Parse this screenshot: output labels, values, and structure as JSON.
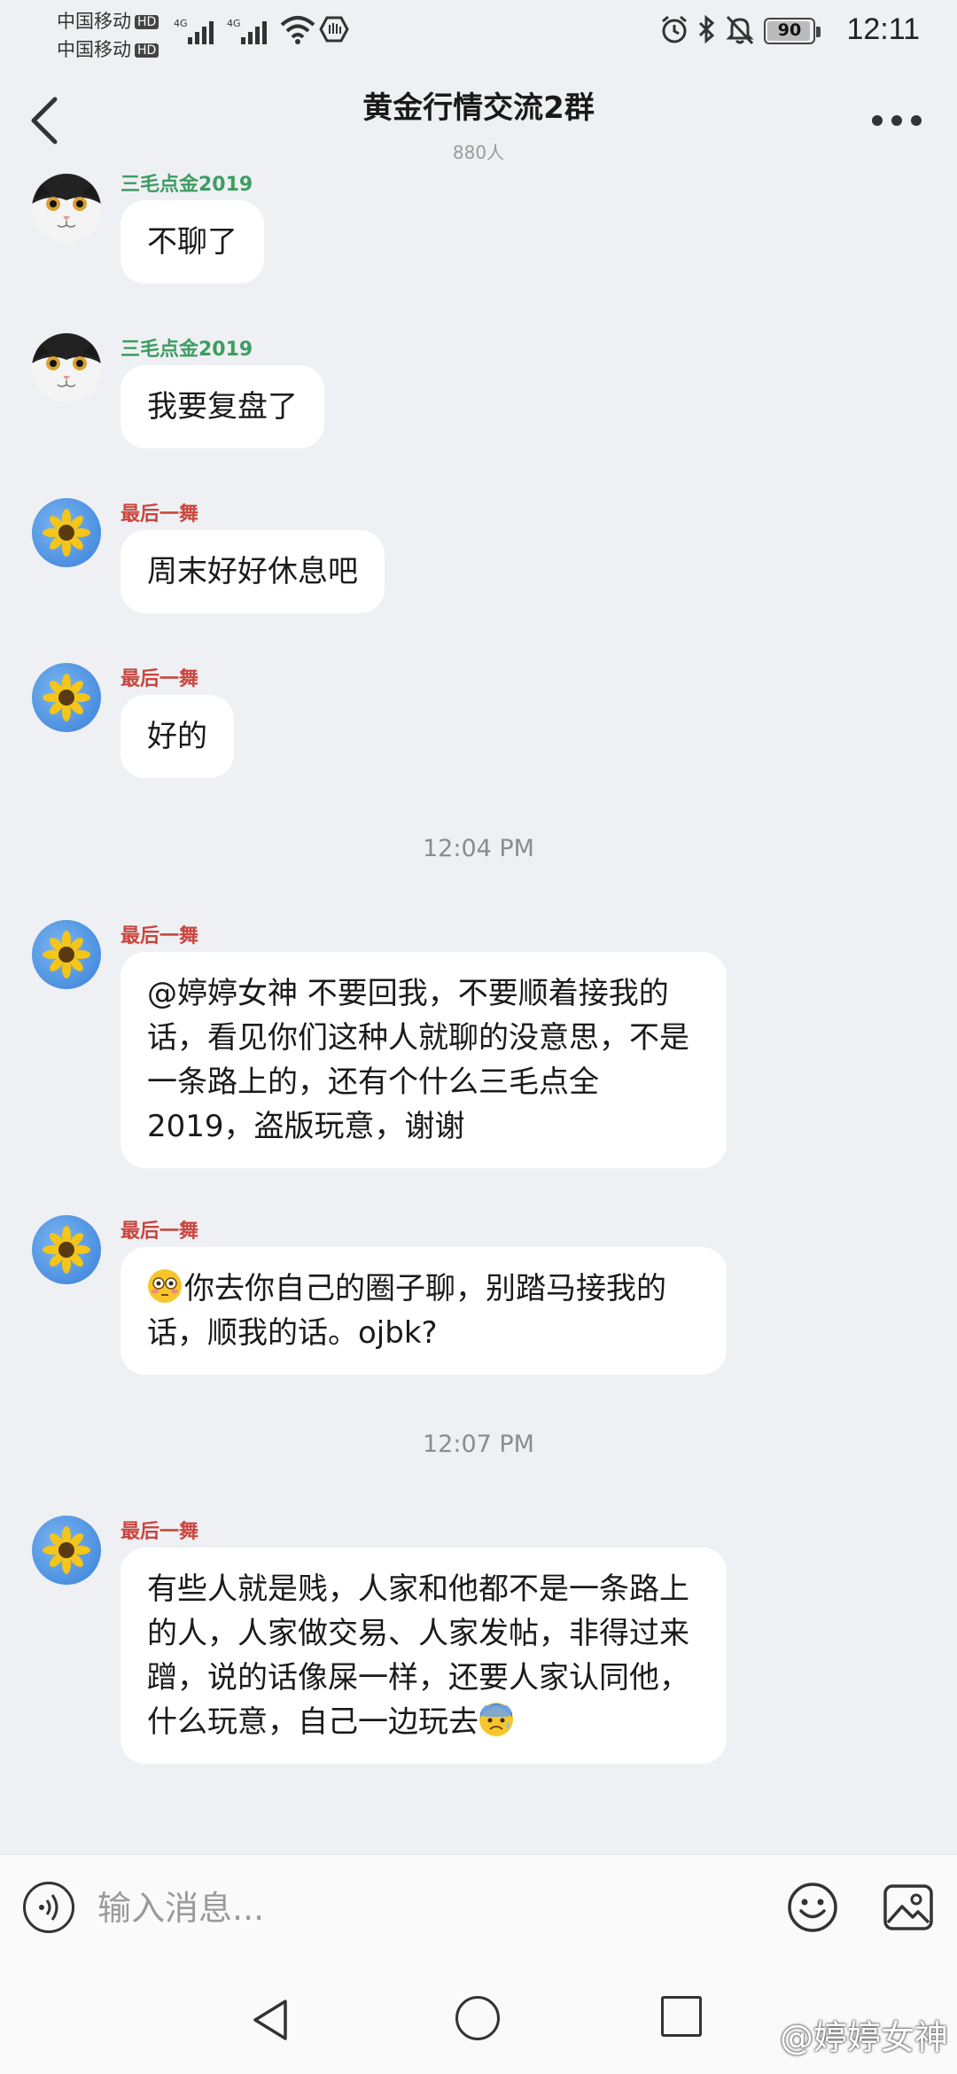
{
  "status_bar": {
    "carrier1": "中国移动",
    "carrier2": "中国移动",
    "hd": "HD",
    "network": "4G",
    "battery": "90",
    "time": "12:11"
  },
  "header": {
    "title": "黄金行情交流2群",
    "member_count": "880人"
  },
  "messages": [
    {
      "sender": "三毛点金2019",
      "avatar": "cat-avatar",
      "text": "不聊了"
    },
    {
      "sender": "三毛点金2019",
      "avatar": "cat-avatar",
      "text": "我要复盘了"
    },
    {
      "sender": "最后一舞",
      "avatar": "sunflower-avatar",
      "text": "周末好好休息吧"
    },
    {
      "sender": "最后一舞",
      "avatar": "sunflower-avatar",
      "text": "好的"
    },
    {
      "timestamp": "12:04 PM"
    },
    {
      "sender": "最后一舞",
      "avatar": "sunflower-avatar",
      "text": "@婷婷女神 不要回我，不要顺着接我的话，看见你们这种人就聊的没意思，不是一条路上的，还有个什么三毛点全2019，盗版玩意，谢谢"
    },
    {
      "sender": "最后一舞",
      "avatar": "sunflower-avatar",
      "emoji": "flushed-face-emoji",
      "text": "你去你自己的圈子聊，别踏马接我的话，顺我的话。ojbk?"
    },
    {
      "timestamp": "12:07 PM"
    },
    {
      "sender": "最后一舞",
      "avatar": "sunflower-avatar",
      "text": "有些人就是贱，人家和他都不是一条路上的人，人家做交易、人家发帖，非得过来蹭，说的话像屎一样，还要人家认同他，什么玩意，自己一边玩去",
      "emoji": "anxious-face-emoji"
    }
  ],
  "input": {
    "placeholder": "输入消息..."
  },
  "watermark": "@婷婷女神",
  "colors": {
    "background": "#eff0f3",
    "bubble": "#ffffff",
    "sender_green": "#3d9d62",
    "sender_red": "#c9463f"
  }
}
